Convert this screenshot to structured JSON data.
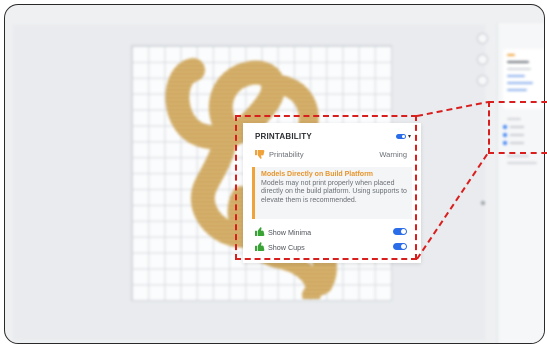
{
  "app": {
    "colors": {
      "accent": "#2b6de8",
      "warning": "#f0a23b",
      "callout": "#d91e1e",
      "model": "#d9b773"
    }
  },
  "popup": {
    "title": "PRINTABILITY",
    "row": {
      "label": "Printability",
      "value": "Warning",
      "icon": "thumbs-down-icon"
    },
    "warning": {
      "title": "Models Directly on Build Platform",
      "text": "Models may not print properly when placed directly on the build platform. Using supports to elevate them is recommended."
    },
    "options": [
      {
        "label": "Show Minima",
        "icon": "thumbs-up-icon",
        "enabled": true
      },
      {
        "label": "Show Cups",
        "icon": "thumbs-up-icon",
        "enabled": true
      }
    ]
  }
}
